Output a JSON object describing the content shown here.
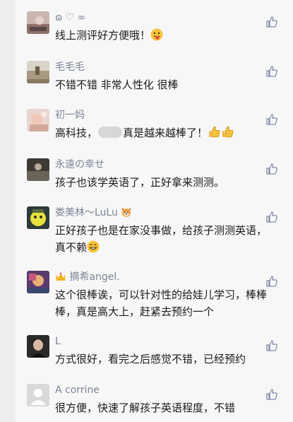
{
  "comments": [
    {
      "name": "ɷ ♡ ∞",
      "text": "线上测评好方便哦！"
    },
    {
      "name": "毛毛毛",
      "text": "不错不错 非常人性化 很棒"
    },
    {
      "name": "初一妈",
      "text_a": "高科技，",
      "text_b": "真是越来越棒了！"
    },
    {
      "name": "永遠の幸せ",
      "text": "孩子也该学英语了，正好拿来测测。"
    },
    {
      "name": "娄美林～LuLu",
      "text": "正好孩子也是在家没事做，给孩子测测英语，真不赖"
    },
    {
      "name": "摘希angel.",
      "text": "这个很棒诶，可以针对性的给娃儿学习，棒棒棒，真是高大上，赶紧去预约一个"
    },
    {
      "name": "L",
      "text": "方式很好，看完之后感觉不错，已经预约"
    },
    {
      "name": "A corrine",
      "text": "很方便，快速了解孩子英语程度，不错"
    }
  ],
  "colors": {
    "name": "#7b8396",
    "text": "#1b1b1b",
    "like_icon": "#7d8aa8",
    "panel": "#f7f7f7",
    "background": "#ededed"
  }
}
